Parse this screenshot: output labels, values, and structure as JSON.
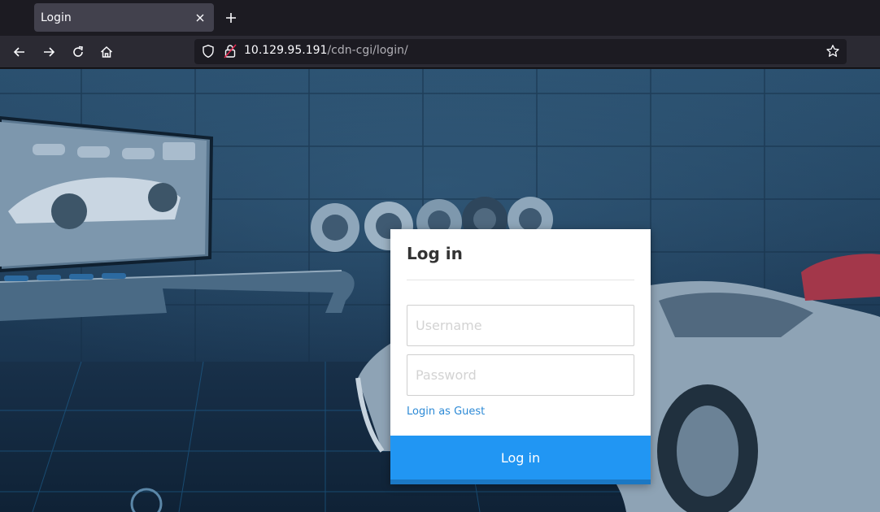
{
  "browser": {
    "tab": {
      "title": "Login"
    },
    "url": {
      "host": "10.129.95.191",
      "path": "/cdn-cgi/login/"
    }
  },
  "login": {
    "title": "Log in",
    "username_placeholder": "Username",
    "password_placeholder": "Password",
    "guest_link": "Login as Guest",
    "submit_label": "Log in",
    "accent_color": "#2196f3"
  },
  "icons": {
    "tab_close": "close-icon",
    "new_tab": "plus-icon",
    "back": "arrow-left-icon",
    "forward": "arrow-right-icon",
    "reload": "reload-icon",
    "home": "home-icon",
    "tracking": "shield-icon",
    "security": "lock-icon",
    "bookmark": "star-icon"
  }
}
